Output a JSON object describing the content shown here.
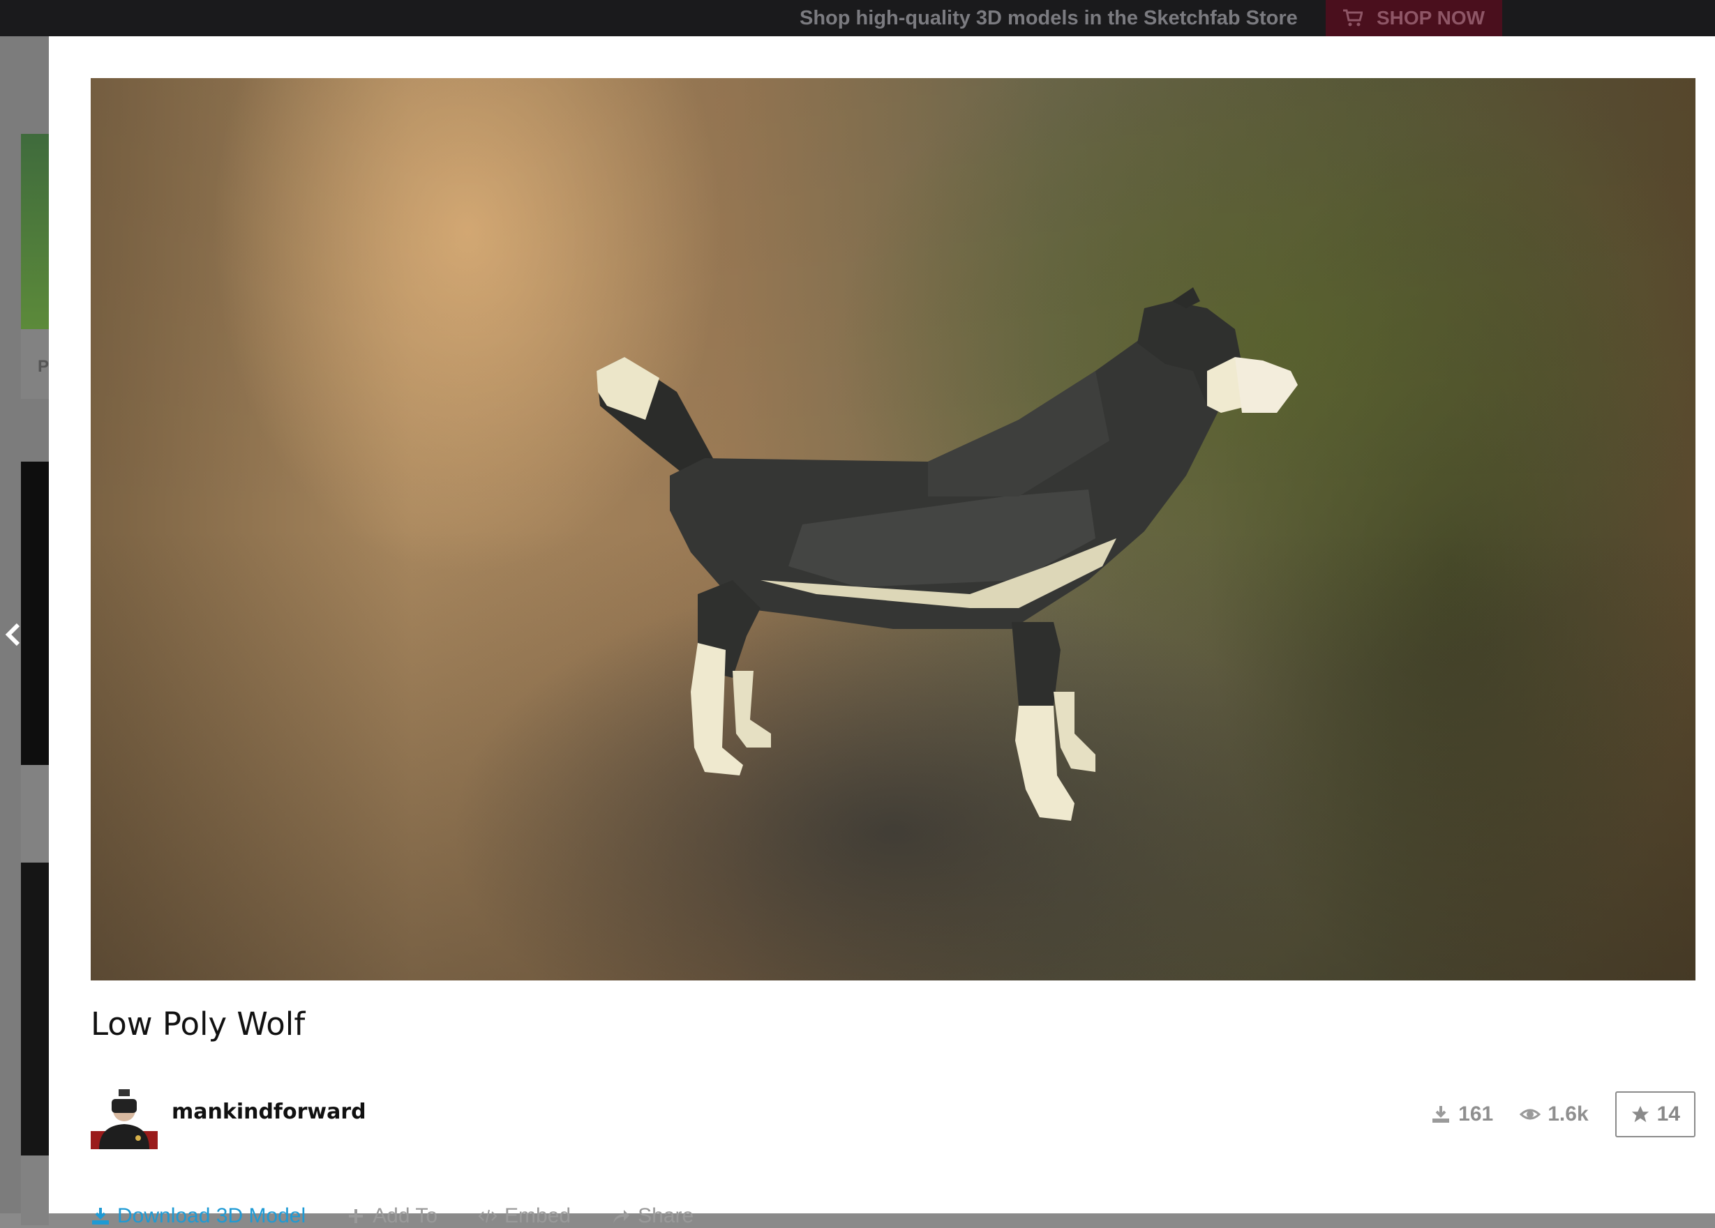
{
  "banner": {
    "text": "Shop high-quality 3D models in the Sketchfab Store",
    "shop_label": "SHOP NOW",
    "shop_icon": "cart-icon"
  },
  "background_page": {
    "letter": "P",
    "prev_icon": "chevron-left-icon"
  },
  "model": {
    "title": "Low Poly Wolf",
    "author": "mankindforward",
    "stats": {
      "downloads": "161",
      "views": "1.6k",
      "likes": "14"
    }
  },
  "actions": {
    "download": "Download 3D Model",
    "add_to": "Add To",
    "embed": "Embed",
    "share": "Share"
  },
  "colors": {
    "accent": "#1e9ad4",
    "banner_bg": "#1a1a1c",
    "shop_button": "#4a0f1d"
  }
}
